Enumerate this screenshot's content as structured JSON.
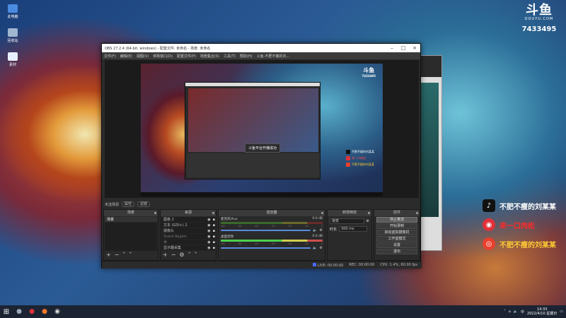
{
  "desktop": {
    "icons": [
      {
        "label": "此电脑",
        "icon": "computer-icon"
      },
      {
        "label": "回收站",
        "icon": "recycle-bin-icon"
      },
      {
        "label": "素材",
        "icon": "folder-icon"
      }
    ]
  },
  "brand": {
    "logo": "斗鱼",
    "domain": "DOUYU.COM",
    "room_id": "7433495"
  },
  "overlay": [
    {
      "icon": "tiktok-icon",
      "text": "不肥不瘦的刘某某",
      "color": "#ffffff",
      "bg": "#111111"
    },
    {
      "icon": "netease-music-icon",
      "text": "来一口肉松",
      "color": "#ff2a2a",
      "bg": "#e0313a"
    },
    {
      "icon": "weibo-icon",
      "text": "不肥不瘦的刘某某",
      "color": "#ffcc33",
      "bg": "#e8402e"
    }
  ],
  "obs": {
    "title": "OBS 27.2.4 (64-bit, windows) - 配置文件: 未命名 - 场景: 未命名",
    "menu": [
      "文件(F)",
      "编辑(E)",
      "视图(V)",
      "停靠窗口(D)",
      "配置文件(P)",
      "场景集合(S)",
      "工具(T)",
      "帮助(H)",
      "斗鱼-不肥不瘦的刘..."
    ],
    "preview_toast": "斗鱼平台开播成功",
    "preview_brand": {
      "logo": "斗鱼",
      "room": "7433495"
    },
    "preview_overlay": [
      "不肥不瘦的刘某某",
      "来一口肉松",
      "不肥不瘦的刘某某"
    ],
    "scene_label": "未选择源",
    "scene_pills": [
      "属性",
      "滤镜"
    ],
    "scenes": {
      "title": "场景",
      "items": [
        "场景"
      ]
    },
    "sources": {
      "title": "来源",
      "items": [
        "图像 2",
        "文本 (GDI+) 2",
        "摄像头",
        "Stand Region",
        "小",
        "显示器采集"
      ]
    },
    "mixer": {
      "title": "混音器",
      "channels": [
        {
          "name": "麦克风/Aux",
          "db": "0.0 dB",
          "active": false
        },
        {
          "name": "桌面音频",
          "db": "0.0 dB",
          "active": true
        }
      ],
      "scale": [
        "-60",
        "-50",
        "-40",
        "-30",
        "-20",
        "-10",
        "0"
      ]
    },
    "transitions": {
      "title": "转场特效",
      "type": "渐变",
      "duration_label": "时长",
      "duration": "300 ms"
    },
    "controls": {
      "title": "控件",
      "buttons": [
        "停止推流",
        "开始录制",
        "启动虚拟摄像机",
        "工作室模式",
        "设置",
        "退出"
      ]
    },
    "status": {
      "live": "LIVE: 00:00:00",
      "rec": "REC: 00:00:00",
      "cpu": "CPU: 1.4%, 60.00 fps"
    }
  },
  "taskbar": {
    "time": "14:33",
    "date": "2022/4/10 星期日"
  }
}
